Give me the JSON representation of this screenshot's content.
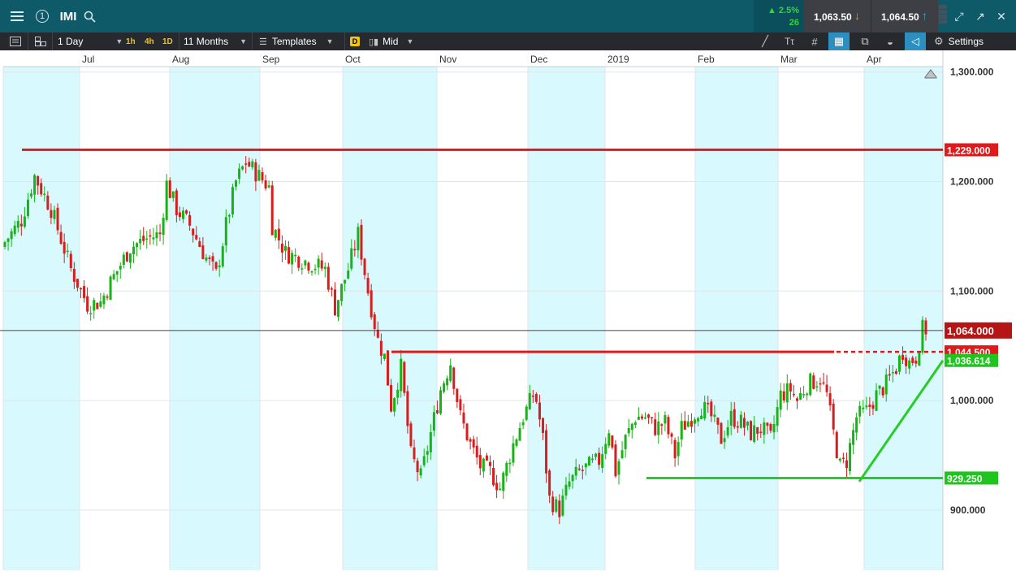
{
  "header": {
    "symbol": "IMI",
    "change_pct": "2.5%",
    "change_abs": "26",
    "sell_price": "1,063.50",
    "buy_price": "1,064.50",
    "alert_count": "1"
  },
  "toolbar": {
    "interval": "1 Day",
    "intervals": [
      "1h",
      "4h",
      "1D"
    ],
    "range": "11 Months",
    "templates_label": "Templates",
    "d_badge": "D",
    "price_type": "Mid",
    "settings_label": "Settings"
  },
  "colors": {
    "up": "#17b317",
    "down": "#d61e1e",
    "band": "#d8f9fd",
    "resistance": "#e01a1a",
    "support": "#27cc27"
  },
  "chart_data": {
    "type": "candlestick",
    "title": "",
    "x_ticks": [
      "Jul",
      "Aug",
      "Sep",
      "Oct",
      "Nov",
      "Dec",
      "2019",
      "Feb",
      "Mar",
      "Apr"
    ],
    "y_ticks": [
      "1,300.000",
      "1,200.000",
      "1,100.000",
      "1,000.000",
      "900.000"
    ],
    "y_tick_values": [
      1300,
      1200,
      1100,
      1000,
      900
    ],
    "ylim": [
      845,
      1305
    ],
    "grid": true,
    "last_price": {
      "label": "1,064.000",
      "value": 1064
    },
    "horizontal_lines": [
      {
        "label": "1,229.000",
        "value": 1229,
        "color": "red",
        "from_month": "Jun",
        "to": "end"
      },
      {
        "label": "1,044.500",
        "value": 1044.5,
        "color": "red",
        "from_month": "Oct",
        "to": "Apr",
        "dashed_extension": true
      },
      {
        "label": "929.250",
        "value": 929.25,
        "color": "green",
        "from_month": "2019",
        "to": "end"
      }
    ],
    "trend_line": {
      "label": "1,036.614",
      "value_at_end": 1036.614,
      "start_value": 926,
      "start_month": "Apr",
      "color": "green"
    },
    "candles_description": "Daily OHLC, Jun 2018 – Apr 2019",
    "ohlc_waypoints_close": [
      [
        0,
        1145
      ],
      [
        5,
        1165
      ],
      [
        9,
        1205
      ],
      [
        14,
        1175
      ],
      [
        20,
        1120
      ],
      [
        25,
        1088
      ],
      [
        29,
        1090
      ],
      [
        32,
        1108
      ],
      [
        38,
        1140
      ],
      [
        43,
        1148
      ],
      [
        47,
        1152
      ],
      [
        49,
        1198
      ],
      [
        52,
        1175
      ],
      [
        56,
        1160
      ],
      [
        61,
        1130
      ],
      [
        64,
        1115
      ],
      [
        67,
        1160
      ],
      [
        70,
        1200
      ],
      [
        73,
        1218
      ],
      [
        77,
        1205
      ],
      [
        80,
        1195
      ],
      [
        81,
        1160
      ],
      [
        85,
        1135
      ],
      [
        89,
        1130
      ],
      [
        93,
        1125
      ],
      [
        97,
        1120
      ],
      [
        100,
        1085
      ],
      [
        104,
        1120
      ],
      [
        107,
        1152
      ],
      [
        110,
        1100
      ],
      [
        113,
        1055
      ],
      [
        115,
        1040
      ],
      [
        117,
        995
      ],
      [
        120,
        1030
      ],
      [
        123,
        950
      ],
      [
        126,
        930
      ],
      [
        129,
        970
      ],
      [
        132,
        1010
      ],
      [
        135,
        1035
      ],
      [
        138,
        985
      ],
      [
        141,
        960
      ],
      [
        144,
        940
      ],
      [
        147,
        935
      ],
      [
        150,
        920
      ],
      [
        154,
        960
      ],
      [
        157,
        985
      ],
      [
        160,
        1005
      ],
      [
        161,
        1000
      ],
      [
        163,
        965
      ],
      [
        165,
        910
      ],
      [
        168,
        900
      ],
      [
        171,
        925
      ],
      [
        174,
        935
      ],
      [
        177,
        940
      ],
      [
        180,
        945
      ],
      [
        183,
        975
      ],
      [
        185,
        935
      ],
      [
        188,
        965
      ],
      [
        191,
        985
      ],
      [
        194,
        985
      ],
      [
        197,
        975
      ],
      [
        200,
        980
      ],
      [
        203,
        950
      ],
      [
        205,
        975
      ],
      [
        208,
        985
      ],
      [
        211,
        995
      ],
      [
        214,
        985
      ],
      [
        217,
        965
      ],
      [
        220,
        985
      ],
      [
        223,
        980
      ],
      [
        226,
        970
      ],
      [
        229,
        975
      ],
      [
        232,
        965
      ],
      [
        235,
        1005
      ],
      [
        238,
        1010
      ],
      [
        240,
        1000
      ],
      [
        243,
        1015
      ],
      [
        247,
        1020
      ],
      [
        249,
        1005
      ],
      [
        251,
        970
      ],
      [
        253,
        940
      ],
      [
        255,
        945
      ],
      [
        258,
        985
      ],
      [
        261,
        990
      ],
      [
        264,
        1005
      ],
      [
        267,
        1015
      ],
      [
        270,
        1030
      ],
      [
        272,
        1045
      ],
      [
        274,
        1035
      ],
      [
        276,
        1040
      ],
      [
        278,
        1065
      ]
    ]
  }
}
